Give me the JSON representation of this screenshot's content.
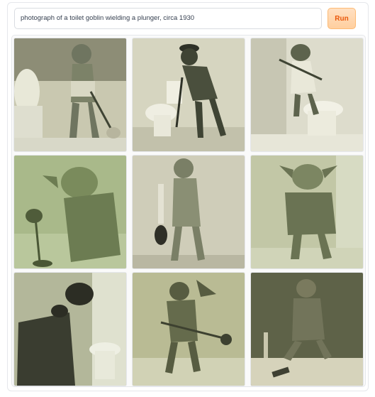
{
  "prompt": {
    "value": "photograph of a toilet goblin wielding a plunger, circa 1930"
  },
  "run_button": {
    "label": "Run"
  },
  "gallery": {
    "images": [
      {
        "name": "goblin-image-1"
      },
      {
        "name": "goblin-image-2"
      },
      {
        "name": "goblin-image-3"
      },
      {
        "name": "goblin-image-4"
      },
      {
        "name": "goblin-image-5"
      },
      {
        "name": "goblin-image-6"
      },
      {
        "name": "goblin-image-7"
      },
      {
        "name": "goblin-image-8"
      },
      {
        "name": "goblin-image-9"
      }
    ],
    "tone_colors": [
      "#c9c8b0",
      "#d6d5c0",
      "#dddccc",
      "#a9b98a",
      "#cfcdb9",
      "#c2c7a6",
      "#b3b79a",
      "#b9bb94",
      "#5e6248"
    ]
  }
}
